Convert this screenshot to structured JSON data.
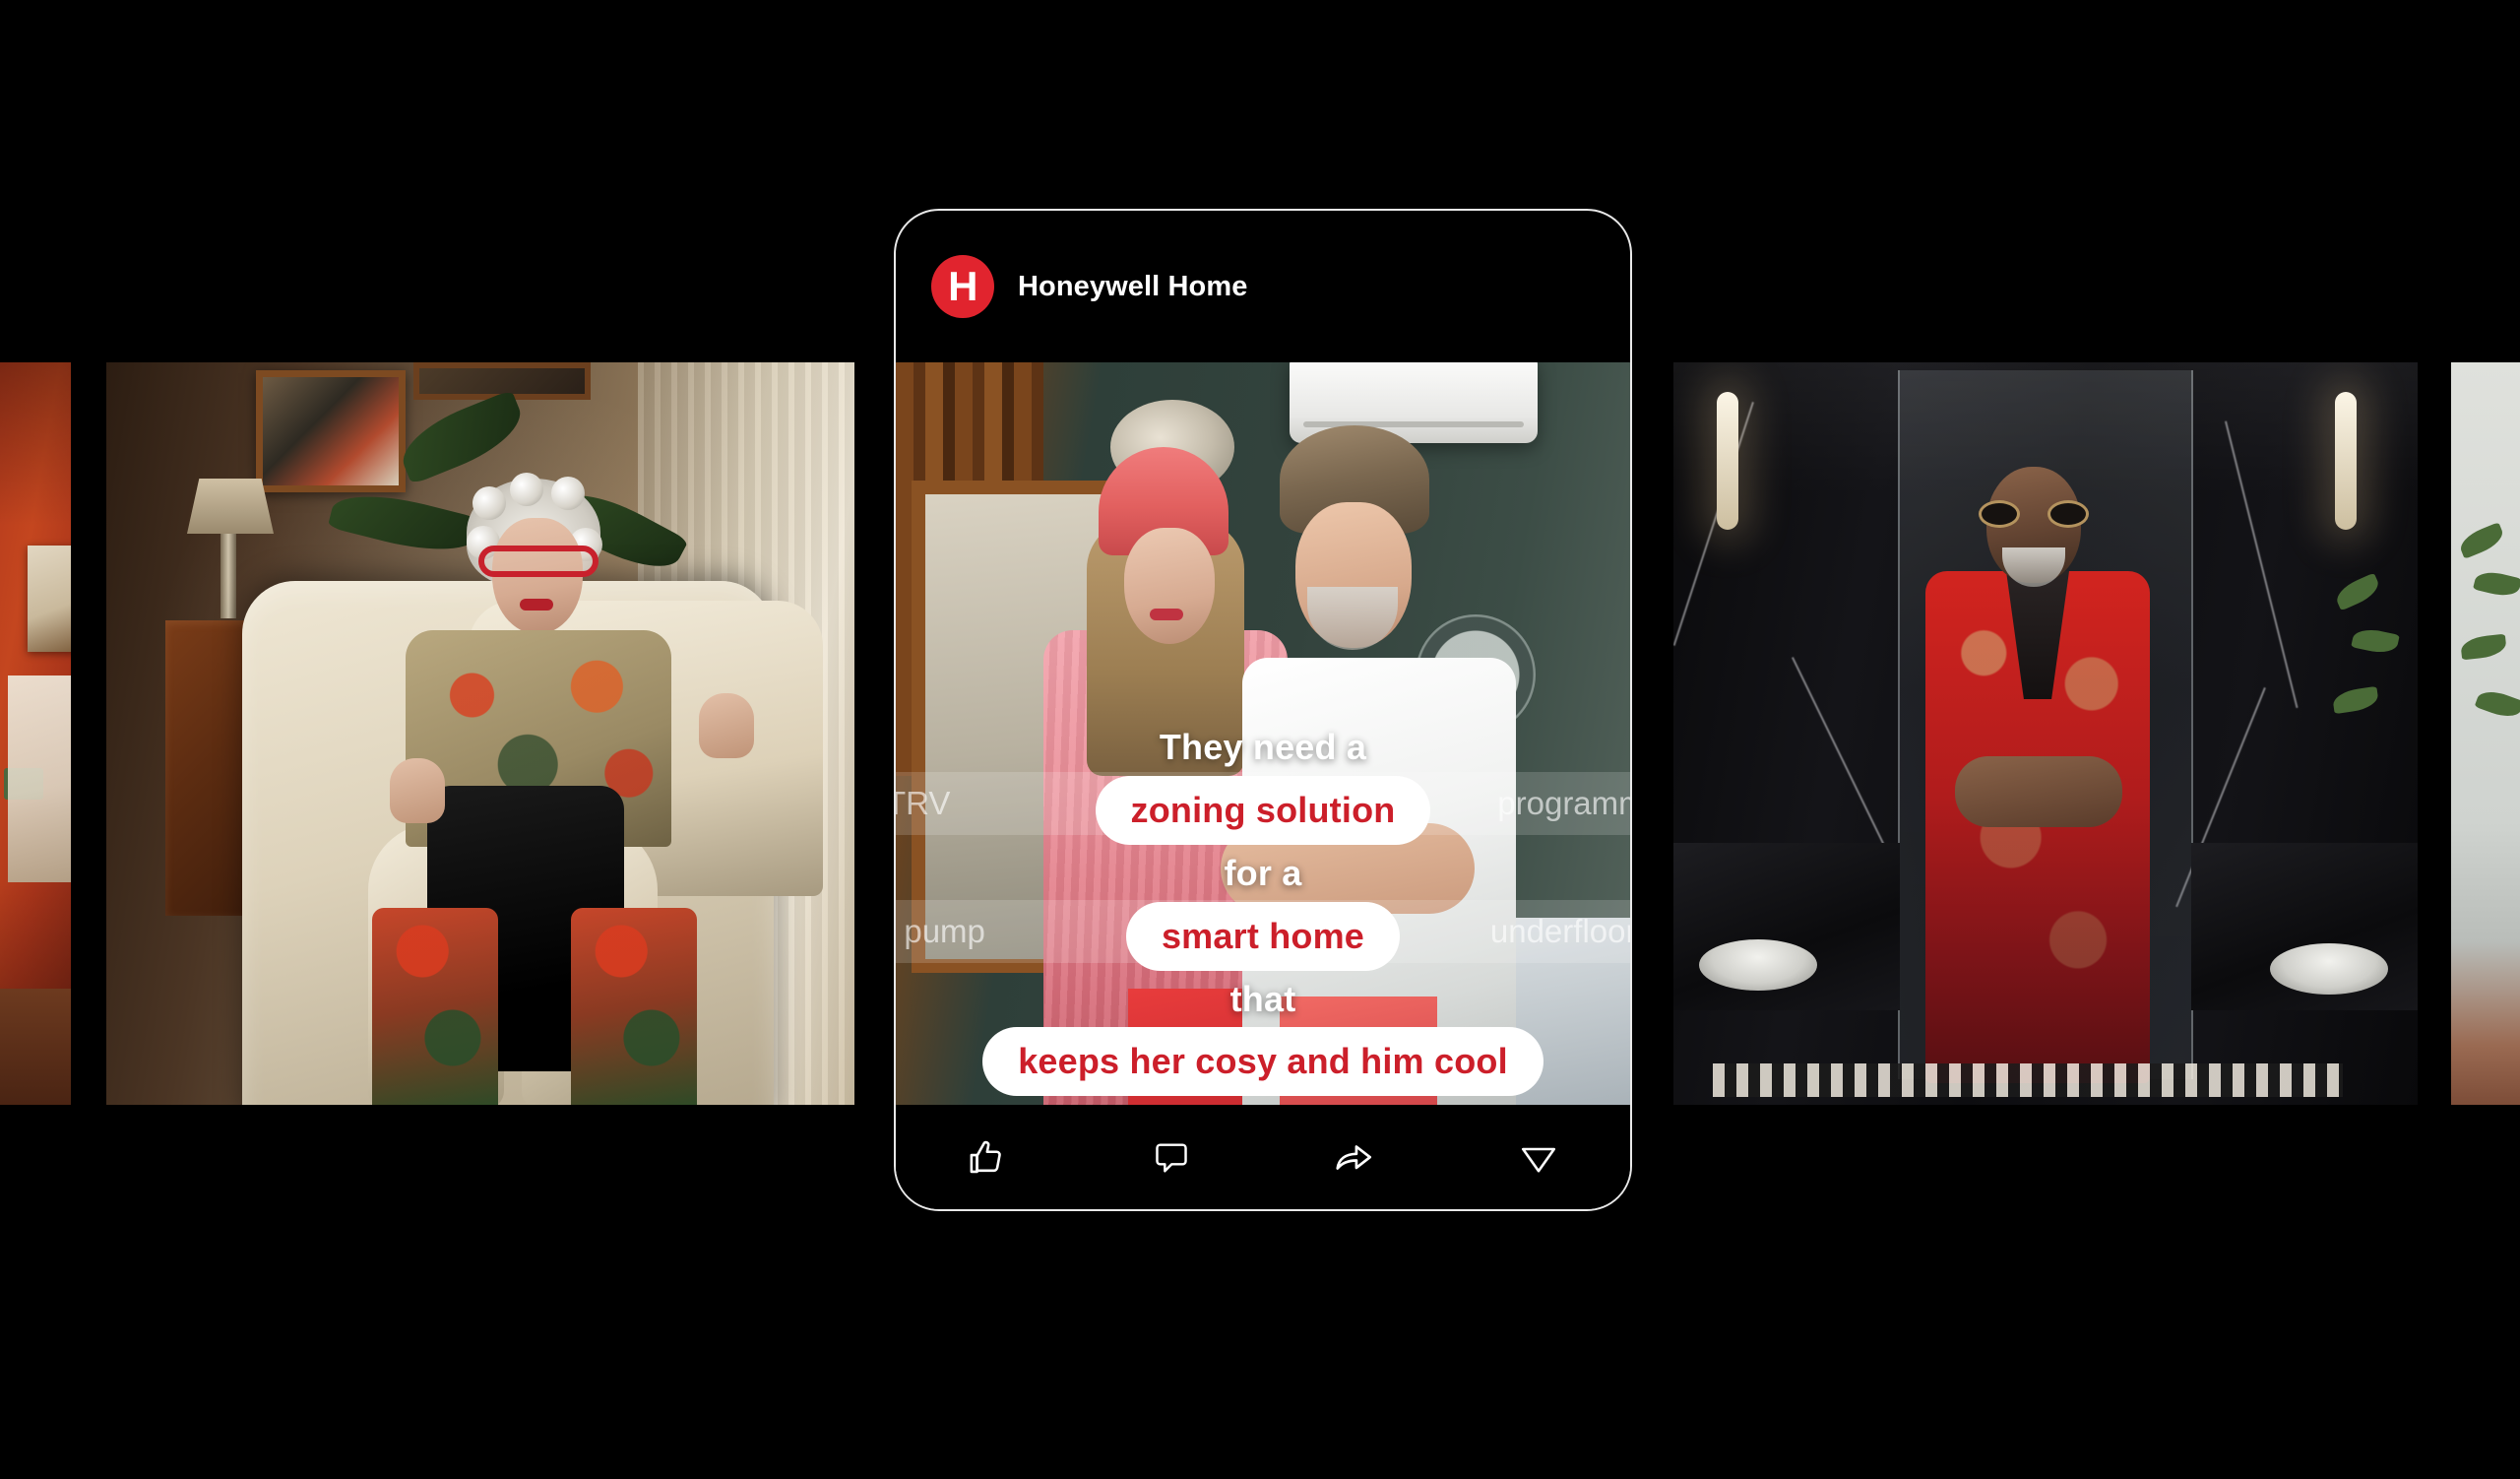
{
  "background": {
    "kind": "photo-filmstrip",
    "tiles": [
      {
        "name": "far-left-sliver",
        "alt": "Warm orange living-room wall partially cropped"
      },
      {
        "name": "left-photo",
        "alt": "Elderly woman with white curly hair and red glasses sitting in a cream leather armchair"
      },
      {
        "name": "right-photo",
        "alt": "Older man in a red patterned robe and sunglasses standing in a dark marble bathroom"
      },
      {
        "name": "far-right-sliver",
        "alt": "Light wall with trailing green plant"
      }
    ]
  },
  "post": {
    "brand": {
      "logo_letter": "H",
      "logo_color": "#e1242e",
      "name": "Honeywell Home"
    },
    "media": {
      "alt": "A woman in a pink beanie and fluffy pink robe stands beside a man in a white t-shirt in a bedroom with an air-conditioning unit and fan"
    },
    "keyword_bands": [
      {
        "left": "TRV",
        "right": "programme"
      },
      {
        "left": "t pump",
        "right": "underfloor h"
      }
    ],
    "caption": [
      {
        "style": "plain",
        "text": "They need a"
      },
      {
        "style": "pill",
        "text": "zoning solution"
      },
      {
        "style": "plain",
        "text": "for a"
      },
      {
        "style": "pill",
        "text": "smart home"
      },
      {
        "style": "plain",
        "text": "that"
      },
      {
        "style": "pill",
        "text": "keeps her cosy and him cool"
      }
    ],
    "caption_colors": {
      "plain_text": "#ffffff",
      "pill_background": "#ffffff",
      "pill_text": "#cc1f2a"
    },
    "actions": [
      {
        "icon": "thumbs-up-icon",
        "label": "Like"
      },
      {
        "icon": "comment-icon",
        "label": "Comment"
      },
      {
        "icon": "share-icon",
        "label": "Share"
      },
      {
        "icon": "send-icon",
        "label": "Send"
      }
    ]
  }
}
